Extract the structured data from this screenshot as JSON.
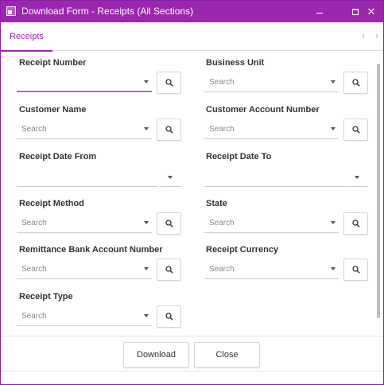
{
  "window": {
    "title": "Download Form - Receipts (All Sections)",
    "minimize_icon": "minimize-icon",
    "maximize_icon": "maximize-icon",
    "close_glyph": "✕"
  },
  "tabs": {
    "active": "Receipts",
    "prev_glyph": "‹",
    "next_glyph": "›"
  },
  "fields": {
    "receipt_number": {
      "label": "Receipt Number",
      "placeholder": ""
    },
    "business_unit": {
      "label": "Business Unit",
      "placeholder": "Search"
    },
    "customer_name": {
      "label": "Customer Name",
      "placeholder": "Search"
    },
    "customer_account_number": {
      "label": "Customer Account Number",
      "placeholder": "Search"
    },
    "receipt_date_from": {
      "label": "Receipt Date From"
    },
    "receipt_date_to": {
      "label": "Receipt Date To"
    },
    "receipt_method": {
      "label": "Receipt Method",
      "placeholder": "Search"
    },
    "state": {
      "label": "State",
      "placeholder": "Search"
    },
    "remittance_bank_account_number": {
      "label": "Remittance Bank Account Number",
      "placeholder": "Search"
    },
    "receipt_currency": {
      "label": "Receipt Currency",
      "placeholder": "Search"
    },
    "receipt_type": {
      "label": "Receipt Type",
      "placeholder": "Search"
    }
  },
  "footer": {
    "download_label": "Download",
    "close_label": "Close"
  },
  "colors": {
    "accent": "#9b27af",
    "focus": "#c35bd1"
  }
}
